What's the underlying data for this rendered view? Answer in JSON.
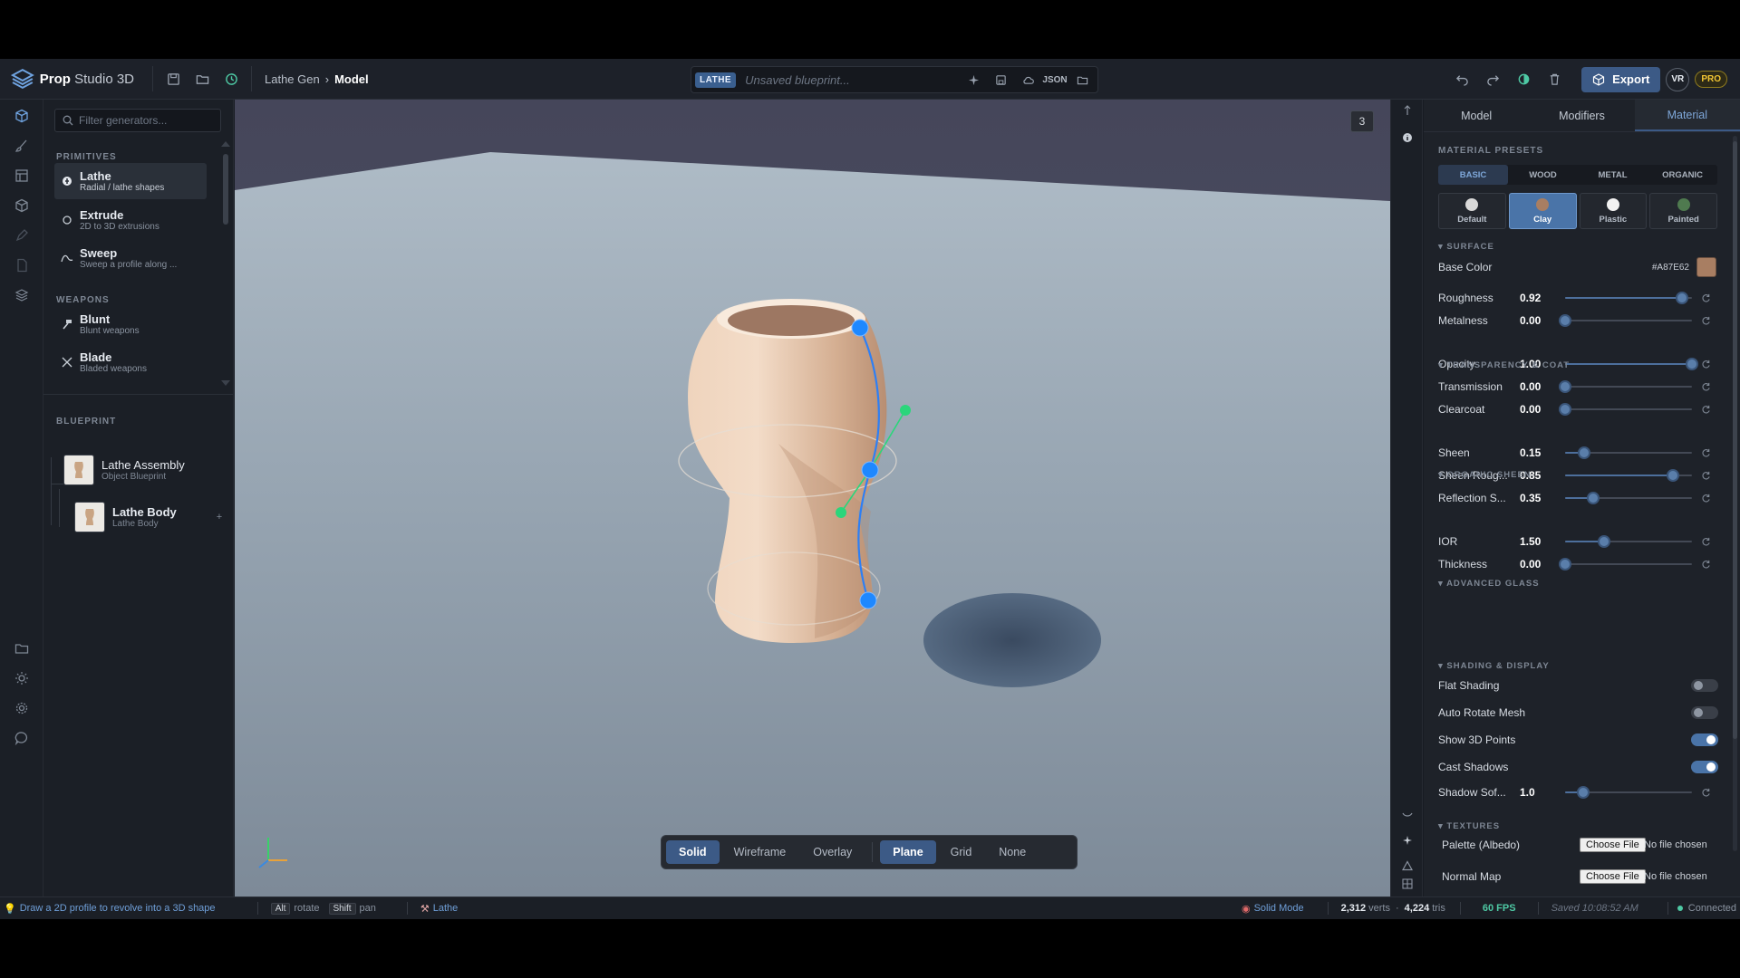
{
  "app": {
    "name_bold": "Prop",
    "name_rest": "Studio 3D"
  },
  "breadcrumb": {
    "parent": "Lathe Gen",
    "separator": "›",
    "current": "Model"
  },
  "blueprint_bar": {
    "tag": "LATHE",
    "name": "Unsaved blueprint...",
    "json_label": "JSON"
  },
  "toolbar": {
    "export_label": "Export",
    "vr_label": "VR",
    "pro_label": "PRO"
  },
  "generators": {
    "filter_placeholder": "Filter generators...",
    "primitives_label": "PRIMITIVES",
    "weapons_label": "WEAPONS",
    "primitives": [
      {
        "title": "Lathe",
        "subtitle": "Radial / lathe shapes"
      },
      {
        "title": "Extrude",
        "subtitle": "2D to 3D extrusions"
      },
      {
        "title": "Sweep",
        "subtitle": "Sweep a profile along ..."
      }
    ],
    "weapons": [
      {
        "title": "Blunt",
        "subtitle": "Blunt weapons"
      },
      {
        "title": "Blade",
        "subtitle": "Bladed weapons"
      }
    ]
  },
  "blueprint": {
    "label": "BLUEPRINT",
    "items": [
      {
        "title": "Lathe Assembly",
        "subtitle": "Object Blueprint"
      },
      {
        "title": "Lathe Body",
        "subtitle": "Lathe Body",
        "action": "+"
      }
    ]
  },
  "viewport": {
    "view_number": "3",
    "render_modes": [
      "Solid",
      "Wireframe",
      "Overlay"
    ],
    "active_render_mode": "Solid",
    "ground_modes": [
      "Plane",
      "Grid",
      "None"
    ],
    "active_ground_mode": "Plane"
  },
  "properties": {
    "tabs": [
      "Model",
      "Modifiers",
      "Material"
    ],
    "active_tab": "Material",
    "material_presets_label": "MATERIAL PRESETS",
    "preset_categories": [
      "BASIC",
      "WOOD",
      "METAL",
      "ORGANIC"
    ],
    "active_category": "BASIC",
    "presets": [
      {
        "label": "Default",
        "color": "#d9d9d9"
      },
      {
        "label": "Clay",
        "color": "#A87E62"
      },
      {
        "label": "Plastic",
        "color": "#f2f2f2"
      },
      {
        "label": "Painted",
        "color": "#4f7a4f"
      }
    ],
    "active_preset": "Clay",
    "surface_label": "SURFACE",
    "base_color_label": "Base Color",
    "base_color_hex": "#A87E62",
    "surface": [
      {
        "label": "Roughness",
        "value": "0.92",
        "fraction": 0.92
      },
      {
        "label": "Metalness",
        "value": "0.00",
        "fraction": 0.0
      }
    ],
    "transparency_label": "TRANSPARENCY & COAT",
    "transparency": [
      {
        "label": "Opacity",
        "value": "1.00",
        "fraction": 1.0
      },
      {
        "label": "Transmission",
        "value": "0.00",
        "fraction": 0.0
      },
      {
        "label": "Clearcoat",
        "value": "0.00",
        "fraction": 0.0
      }
    ],
    "sheen_label": "ORGANIC SHEEN",
    "sheen": [
      {
        "label": "Sheen",
        "value": "0.15",
        "fraction": 0.15
      },
      {
        "label": "Sheen Roug...",
        "value": "0.85",
        "fraction": 0.85
      },
      {
        "label": "Reflection S...",
        "value": "0.35",
        "fraction": 0.22
      }
    ],
    "glass_label": "ADVANCED GLASS",
    "glass": [
      {
        "label": "IOR",
        "value": "1.50",
        "fraction": 0.31
      },
      {
        "label": "Thickness",
        "value": "0.00",
        "fraction": 0.0
      }
    ],
    "shading_label": "SHADING & DISPLAY",
    "toggles": [
      {
        "label": "Flat Shading",
        "on": false
      },
      {
        "label": "Auto Rotate Mesh",
        "on": false
      },
      {
        "label": "Show 3D Points",
        "on": true
      },
      {
        "label": "Cast Shadows",
        "on": true
      }
    ],
    "shadow_soft": {
      "label": "Shadow Sof...",
      "value": "1.0",
      "fraction": 0.14
    },
    "textures_label": "TEXTURES",
    "textures": [
      {
        "label": "Palette (Albedo)",
        "button": "Choose File",
        "status": "No file chosen"
      },
      {
        "label": "Normal Map",
        "button": "Choose File",
        "status": "No file chosen"
      }
    ]
  },
  "status": {
    "hint": "Draw a 2D profile to revolve into a 3D shape",
    "alt_key": "Alt",
    "alt_action": "rotate",
    "shift_key": "Shift",
    "shift_action": "pan",
    "generator": "Lathe",
    "mode": "Solid Mode",
    "verts": "2,312",
    "verts_label": "verts",
    "tris": "4,224",
    "tris_label": "tris",
    "fps": "60 FPS",
    "saved": "Saved 10:08:52 AM",
    "connection": "Connected"
  },
  "colors": {
    "accent": "#3c5a86",
    "link": "#7ea7d9",
    "fps": "#4ec9a4",
    "connected": "#4ec9a4",
    "hint": "#6f9fd8",
    "pro": "#f2c633"
  }
}
